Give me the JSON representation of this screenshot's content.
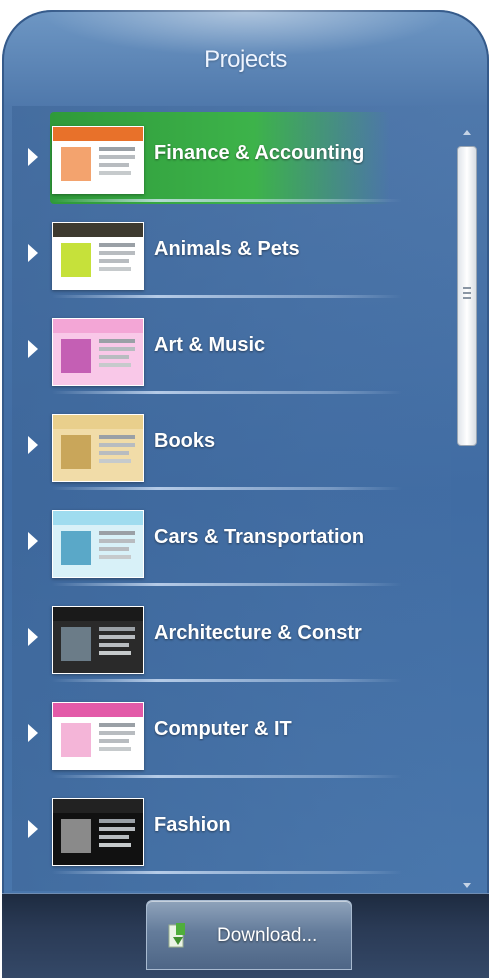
{
  "panel": {
    "title": "Projects"
  },
  "projects": [
    {
      "label": "Finance & Accounting",
      "selected": true,
      "thumb_colors": [
        "#e8712a",
        "#f3a36e",
        "#ffffff"
      ]
    },
    {
      "label": "Animals & Pets",
      "selected": false,
      "thumb_colors": [
        "#3e3a2f",
        "#c6e13a",
        "#ffffff"
      ]
    },
    {
      "label": "Art & Music",
      "selected": false,
      "thumb_colors": [
        "#f3a6d6",
        "#c45fb4",
        "#f9c8e8"
      ]
    },
    {
      "label": "Books",
      "selected": false,
      "thumb_colors": [
        "#e9cf8c",
        "#c9a65a",
        "#f1dca8"
      ]
    },
    {
      "label": "Cars & Transportation",
      "selected": false,
      "thumb_colors": [
        "#9fdcef",
        "#5aa8c8",
        "#d8f1f8"
      ]
    },
    {
      "label": "Architecture & Constr",
      "selected": false,
      "thumb_colors": [
        "#1a1a1a",
        "#6b7c88",
        "#2a2a2a"
      ]
    },
    {
      "label": "Computer & IT",
      "selected": false,
      "thumb_colors": [
        "#e35aa8",
        "#f4b5d8",
        "#ffffff"
      ]
    },
    {
      "label": "Fashion",
      "selected": false,
      "thumb_colors": [
        "#222222",
        "#8a8a8a",
        "#111111"
      ]
    }
  ],
  "footer": {
    "download_label": "Download..."
  },
  "icons": {
    "expand": "triangle-right-icon",
    "download": "download-icon"
  },
  "colors": {
    "selected_bg": "#3db34a",
    "panel_bg": "#406ca3"
  }
}
